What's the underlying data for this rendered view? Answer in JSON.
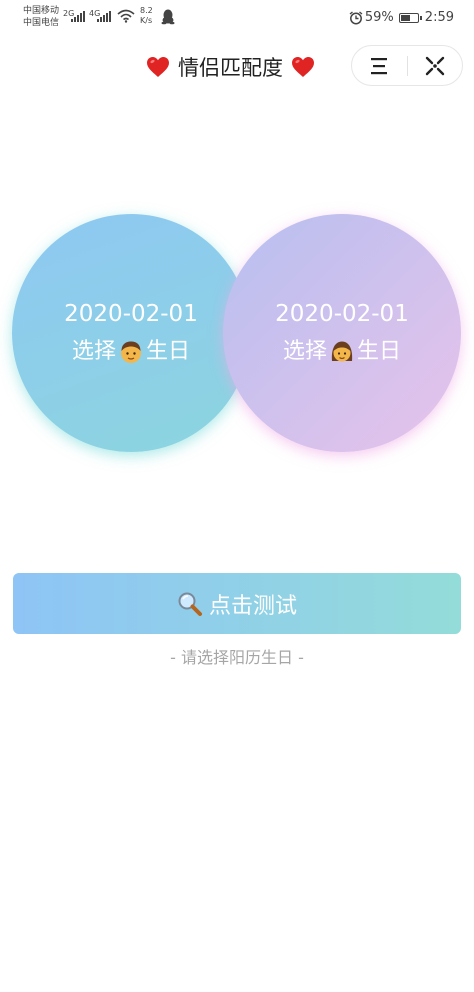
{
  "status_bar": {
    "carrier_1": "中国移动",
    "carrier_2": "中国电信",
    "net_1": "2G",
    "net_2": "4G",
    "speed_value": "8.2",
    "speed_unit": "K/s",
    "battery_percent": "59%",
    "battery_level": 0.59,
    "time": "2:59"
  },
  "header": {
    "title": "情侣匹配度"
  },
  "male": {
    "date": "2020-02-01",
    "pick_prefix": "选择",
    "pick_suffix": "生日"
  },
  "female": {
    "date": "2020-02-01",
    "pick_prefix": "选择",
    "pick_suffix": "生日"
  },
  "test_button": {
    "label": "点击测试"
  },
  "hint": "- 请选择阳历生日 -",
  "colors": {
    "male_gradient": [
      "#8ec8f2",
      "#8cd5df"
    ],
    "female_gradient": [
      "#b7bff0",
      "#e7c3ea"
    ],
    "button_gradient": [
      "#8ec4f6",
      "#93dcd9"
    ],
    "heart": "#e02424"
  }
}
